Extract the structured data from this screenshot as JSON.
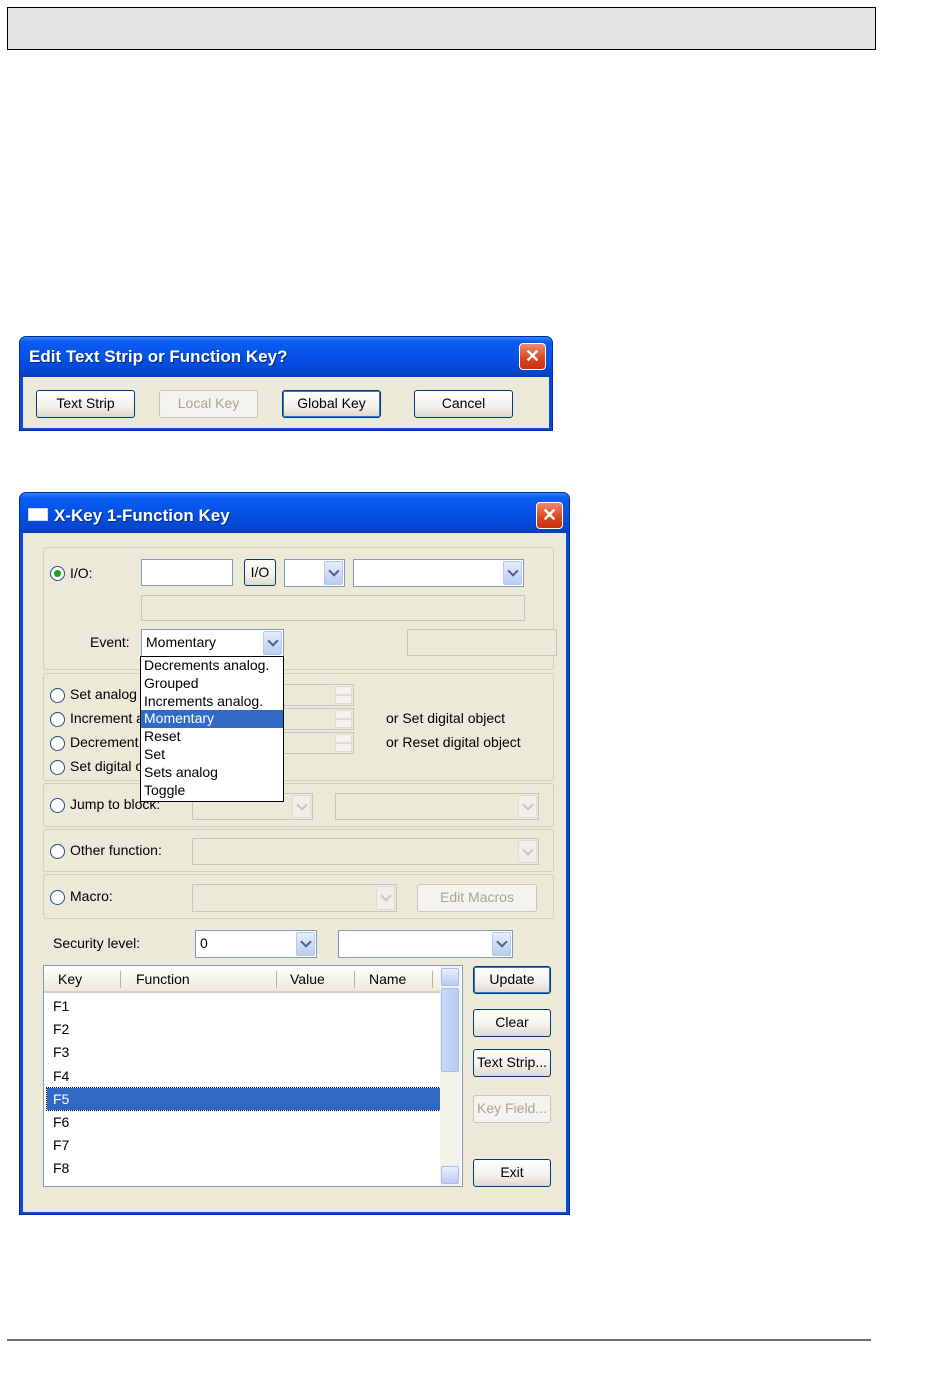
{
  "dialog1": {
    "title": "Edit Text Strip or Function Key?",
    "close_label": "✕",
    "buttons": {
      "text_strip": "Text Strip",
      "local_key": "Local Key",
      "global_key": "Global Key",
      "cancel": "Cancel"
    }
  },
  "dialog2": {
    "title": "X-Key 1-Function Key",
    "close_label": "✕",
    "io": {
      "radio_label": "I/O:",
      "io_button": "I/O",
      "event_label": "Event:",
      "event_value": "Momentary"
    },
    "event_options": [
      "Decrements analog.",
      "Grouped",
      "Increments analog.",
      "Momentary",
      "Reset",
      "Set",
      "Sets analog",
      "Toggle"
    ],
    "event_selected": "Momentary",
    "analog": {
      "set_analog": "Set analog",
      "increment": "Increment a",
      "decrement": "Decrement",
      "set_digital": "Set digital o",
      "or_set": "or Set digital object",
      "or_reset": "or Reset digital object"
    },
    "jump_label": "Jump to block:",
    "other_label": "Other function:",
    "macro_label": "Macro:",
    "edit_macros": "Edit Macros",
    "security_label": "Security level:",
    "security_value": "0",
    "columns": [
      "Key",
      "Function",
      "Value",
      "Name"
    ],
    "rows": [
      "F1",
      "F2",
      "F3",
      "F4",
      "F5",
      "F6",
      "F7",
      "F8"
    ],
    "selected_row": "F5",
    "buttons": {
      "update": "Update",
      "clear": "Clear",
      "text_strip": "Text Strip...",
      "key_field": "Key Field...",
      "exit": "Exit"
    }
  }
}
